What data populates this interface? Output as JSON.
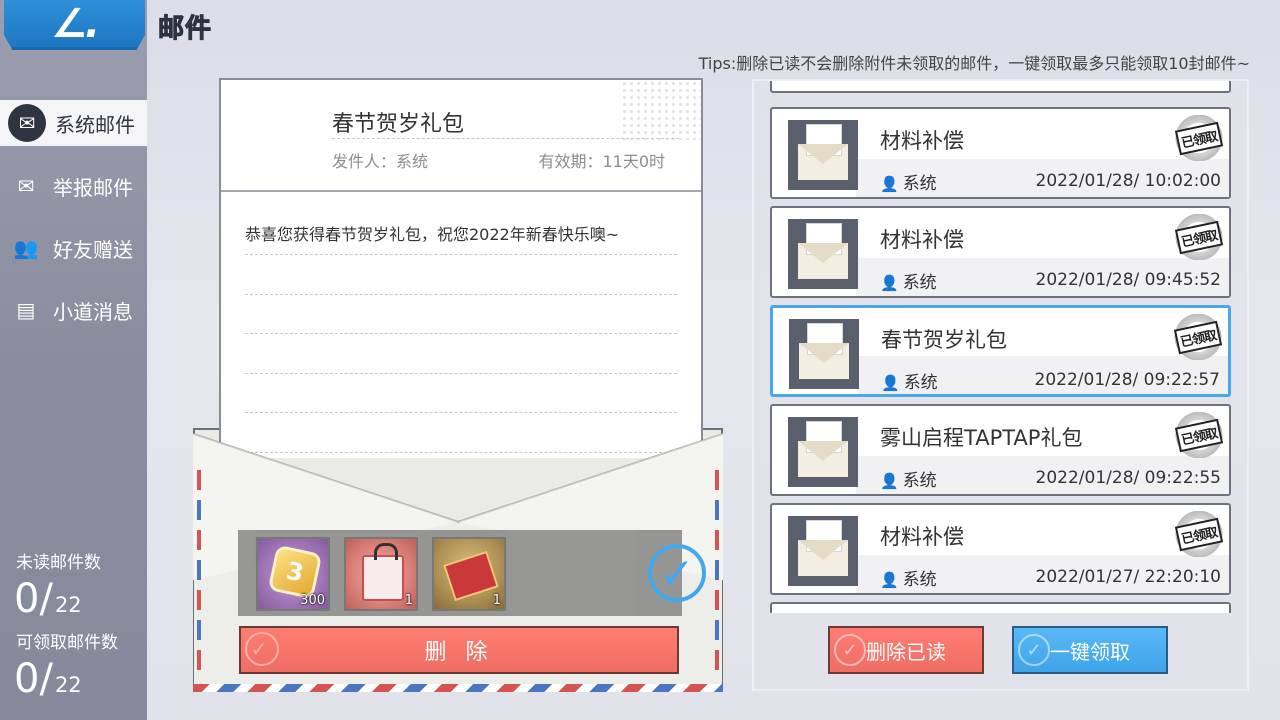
{
  "header": {
    "title": "邮件",
    "tips": "Tips:删除已读不会删除附件未领取的邮件，一键领取最多只能领取10封邮件~"
  },
  "sidebar": {
    "items": [
      {
        "label": "系统邮件",
        "icon": "system-mail-icon",
        "active": true
      },
      {
        "label": "举报邮件",
        "icon": "report-mail-icon",
        "active": false
      },
      {
        "label": "好友赠送",
        "icon": "friends-gift-icon",
        "active": false
      },
      {
        "label": "小道消息",
        "icon": "news-icon",
        "active": false
      }
    ],
    "unread_label": "未读邮件数",
    "unread_count": "0/",
    "unread_total": "22",
    "claimable_label": "可领取邮件数",
    "claimable_count": "0/",
    "claimable_total": "22"
  },
  "letter": {
    "title": "春节贺岁礼包",
    "sender": "发件人：系统",
    "validity": "有效期：11天0时",
    "body": "恭喜您获得春节贺岁礼包，祝您2022年新春快乐噢~",
    "attachments": [
      {
        "name": "coin-item",
        "qty": "300",
        "icon_text": "3"
      },
      {
        "name": "gift-bag-item",
        "qty": "1"
      },
      {
        "name": "red-envelope-item",
        "qty": "1"
      }
    ],
    "delete_label": "删 除"
  },
  "mail_list": {
    "items": [
      {
        "title": "材料补偿",
        "sender": "系统",
        "date": "2022/01/28/ 10:02:00",
        "badge": "已领取",
        "selected": false
      },
      {
        "title": "材料补偿",
        "sender": "系统",
        "date": "2022/01/28/ 09:45:52",
        "badge": "已领取",
        "selected": false
      },
      {
        "title": "春节贺岁礼包",
        "sender": "系统",
        "date": "2022/01/28/ 09:22:57",
        "badge": "已领取",
        "selected": true
      },
      {
        "title": "雾山启程TAPTAP礼包",
        "sender": "系统",
        "date": "2022/01/28/ 09:22:55",
        "badge": "已领取",
        "selected": false
      },
      {
        "title": "材料补偿",
        "sender": "系统",
        "date": "2022/01/27/ 22:20:10",
        "badge": "已领取",
        "selected": false
      }
    ],
    "delete_read_label": "删除已读",
    "claim_all_label": "一键领取"
  },
  "colors": {
    "accent_blue": "#3ea4ea",
    "delete_red": "#f06d63",
    "sidebar_bg": "#8a8d9e"
  }
}
